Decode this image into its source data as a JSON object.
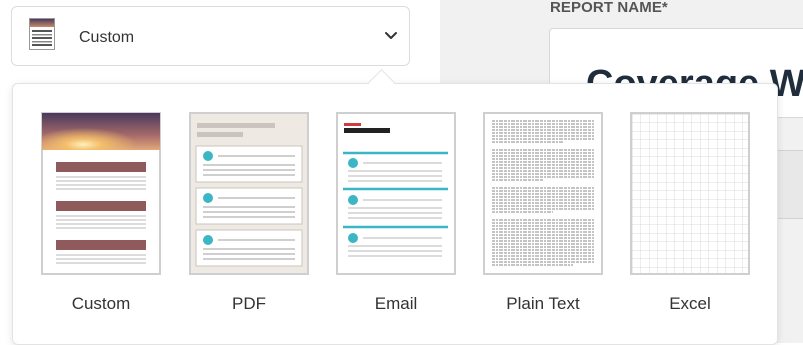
{
  "dropdown": {
    "selected_label": "Custom",
    "icon": "document-icon",
    "chevron_icon": "chevron-down-icon"
  },
  "report_name": {
    "label": "REPORT NAME*",
    "value": "Coverage W"
  },
  "templates": [
    {
      "id": "custom",
      "label": "Custom",
      "icon": "custom-template-icon",
      "selected": true
    },
    {
      "id": "pdf",
      "label": "PDF",
      "icon": "pdf-template-icon",
      "selected": false
    },
    {
      "id": "email",
      "label": "Email",
      "icon": "email-template-icon",
      "selected": false
    },
    {
      "id": "plain-text",
      "label": "Plain Text",
      "icon": "plain-text-template-icon",
      "selected": false
    },
    {
      "id": "excel",
      "label": "Excel",
      "icon": "excel-template-icon",
      "selected": false
    }
  ],
  "colors": {
    "custom_header_top": "#4a3a5c",
    "custom_header_sun": "#f7c26a",
    "custom_bars": "#8e5a5b",
    "pdf_background": "#eeeae3",
    "accent_teal": "#3bb6c4",
    "email_red": "#d23b3b",
    "email_black": "#222222"
  }
}
